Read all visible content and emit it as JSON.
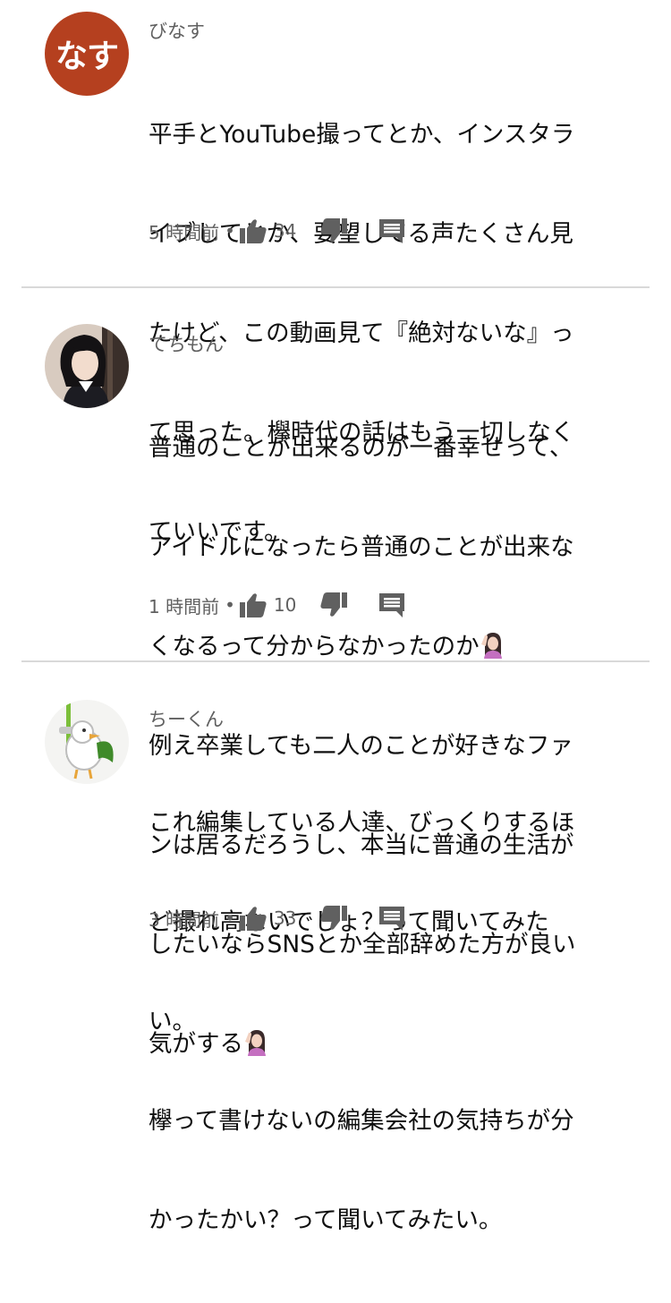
{
  "comments": [
    {
      "author": "びなす",
      "avatar_text": "なす",
      "avatar_color": "#b5401f",
      "lines": [
        "平手とYouTube撮ってとか、インスタラ",
        "イブしてとか、要望してる声たくさん見",
        "たけど、この動画見て『絶対ないな』っ",
        "て思った。欅時代の話はもう一切しなく",
        "ていいです。"
      ],
      "time": "5 時間前",
      "likes": "34"
    },
    {
      "author": "てちもん",
      "avatar_desc": "photo-avatar",
      "lines": [
        "普通のことが出来るのが一番幸せって、",
        "アイドルになったら普通のことが出来な",
        "くなるって分からなかったのか",
        "例え卒業しても二人のことが好きなファ",
        "ンは居るだろうし、本当に普通の生活が",
        "したいならSNSとか全部辞めた方が良い",
        "気がする"
      ],
      "emoji": "woman-tipping-hand-emoji",
      "time": "1 時間前",
      "likes": "10"
    },
    {
      "author": "ちーくん",
      "avatar_desc": "bird-character-avatar",
      "lines": [
        "これ編集している人達、びっくりするほ",
        "ど撮れ高ないでしょ？って聞いてみた",
        "い。",
        "欅って書けないの編集会社の気持ちが分",
        "かったかい？って聞いてみたい。"
      ],
      "time": "3 時間前",
      "likes": "33"
    }
  ],
  "separator": "•",
  "icons": {
    "like": "thumbs-up-icon",
    "dislike": "thumbs-down-icon",
    "reply": "reply-comment-icon"
  },
  "colors": {
    "text": "#0f0f0f",
    "meta": "#606060",
    "icon": "#606060",
    "divider": "#d9d9d9"
  }
}
